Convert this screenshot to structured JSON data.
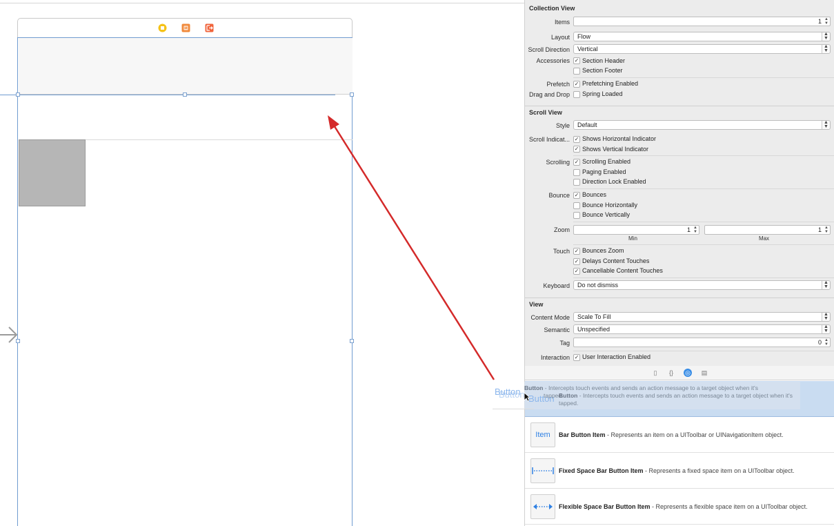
{
  "canvas": {
    "scene_icons": [
      "view-controller-icon",
      "first-responder-icon",
      "exit-icon"
    ]
  },
  "inspector": {
    "collection_view": {
      "title": "Collection View",
      "items_label": "Items",
      "items_value": "1",
      "layout_label": "Layout",
      "layout_value": "Flow",
      "scroll_direction_label": "Scroll Direction",
      "scroll_direction_value": "Vertical",
      "accessories_label": "Accessories",
      "section_header": "Section Header",
      "section_footer": "Section Footer",
      "prefetch_label": "Prefetch",
      "prefetching_enabled": "Prefetching Enabled",
      "drag_drop_label": "Drag and Drop",
      "spring_loaded": "Spring Loaded"
    },
    "scroll_view": {
      "title": "Scroll View",
      "style_label": "Style",
      "style_value": "Default",
      "indicators_label": "Scroll Indicat...",
      "shows_horizontal": "Shows Horizontal Indicator",
      "shows_vertical": "Shows Vertical Indicator",
      "scrolling_label": "Scrolling",
      "scrolling_enabled": "Scrolling Enabled",
      "paging_enabled": "Paging Enabled",
      "direction_lock": "Direction Lock Enabled",
      "bounce_label": "Bounce",
      "bounces": "Bounces",
      "bounce_horizontally": "Bounce Horizontally",
      "bounce_vertically": "Bounce Vertically",
      "zoom_label": "Zoom",
      "zoom_min_value": "1",
      "zoom_max_value": "1",
      "zoom_min_label": "Min",
      "zoom_max_label": "Max",
      "touch_label": "Touch",
      "bounces_zoom": "Bounces Zoom",
      "delays_content_touches": "Delays Content Touches",
      "cancellable_content_touches": "Cancellable Content Touches",
      "keyboard_label": "Keyboard",
      "keyboard_value": "Do not dismiss"
    },
    "view": {
      "title": "View",
      "content_mode_label": "Content Mode",
      "content_mode_value": "Scale To Fill",
      "semantic_label": "Semantic",
      "semantic_value": "Unspecified",
      "tag_label": "Tag",
      "tag_value": "0",
      "interaction_label": "Interaction",
      "user_interaction_enabled": "User Interaction Enabled"
    }
  },
  "library": {
    "tabs": [
      "file-template-icon",
      "code-snippet-icon",
      "object-library-icon",
      "media-library-icon"
    ],
    "items": [
      {
        "thumb": "",
        "name": "Button",
        "description": " - Intercepts touch events and sends an action message to a target object when it's tapped."
      },
      {
        "thumb": "Item",
        "name": "Bar Button Item",
        "description": " - Represents an item on a UIToolbar or UINavigationItem object."
      },
      {
        "thumb": "",
        "name": "Fixed Space Bar Button Item",
        "description": " - Represents a fixed space item on a UIToolbar object."
      },
      {
        "thumb": "",
        "name": "Flexible Space Bar Button Item",
        "description": " - Represents a flexible space item on a UIToolbar object."
      }
    ]
  },
  "drag_ghost": {
    "button_label": "Button",
    "button_label_2": "Button",
    "button_label_3": "Button",
    "text_name": "Button",
    "text_line1": " - Intercepts touch events and sends an action message to a target object when it's",
    "text_line2_word": "tapped.",
    "text2_name": "Button",
    "text2_line1": " - Intercepts touch events and sends an action message to a target object when it's",
    "text2_line2": "tapped."
  },
  "colors": {
    "accent": "#3a8ee6",
    "arrow": "#d42a2a",
    "selection": "#c9dcf1"
  }
}
